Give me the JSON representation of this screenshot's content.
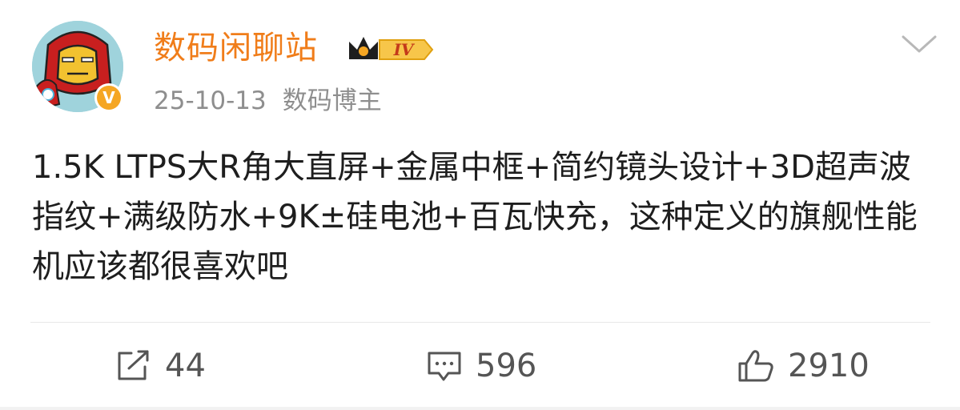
{
  "post": {
    "author": {
      "name": "数码闲聊站",
      "level": "IV",
      "verified_mark": "V",
      "avatar_icon": "iron-man-avatar"
    },
    "date": "25-10-13",
    "role": "数码博主",
    "text": "1.5K LTPS大R角大直屏+金属中框+简约镜头设计+3D超声波指纹+满级防水+9K±硅电池+百瓦快充，这种定义的旗舰性能机应该都很喜欢吧",
    "actions": {
      "repost": {
        "icon": "share-icon",
        "count": "44"
      },
      "comment": {
        "icon": "comment-icon",
        "count": "596"
      },
      "like": {
        "icon": "thumbs-up-icon",
        "count": "2910"
      }
    },
    "menu_icon": "chevron-down-icon"
  },
  "colors": {
    "username": "#f07d1a",
    "meta": "#8e8e8e",
    "verified": "#f5a623",
    "text": "#1e1e1e"
  }
}
